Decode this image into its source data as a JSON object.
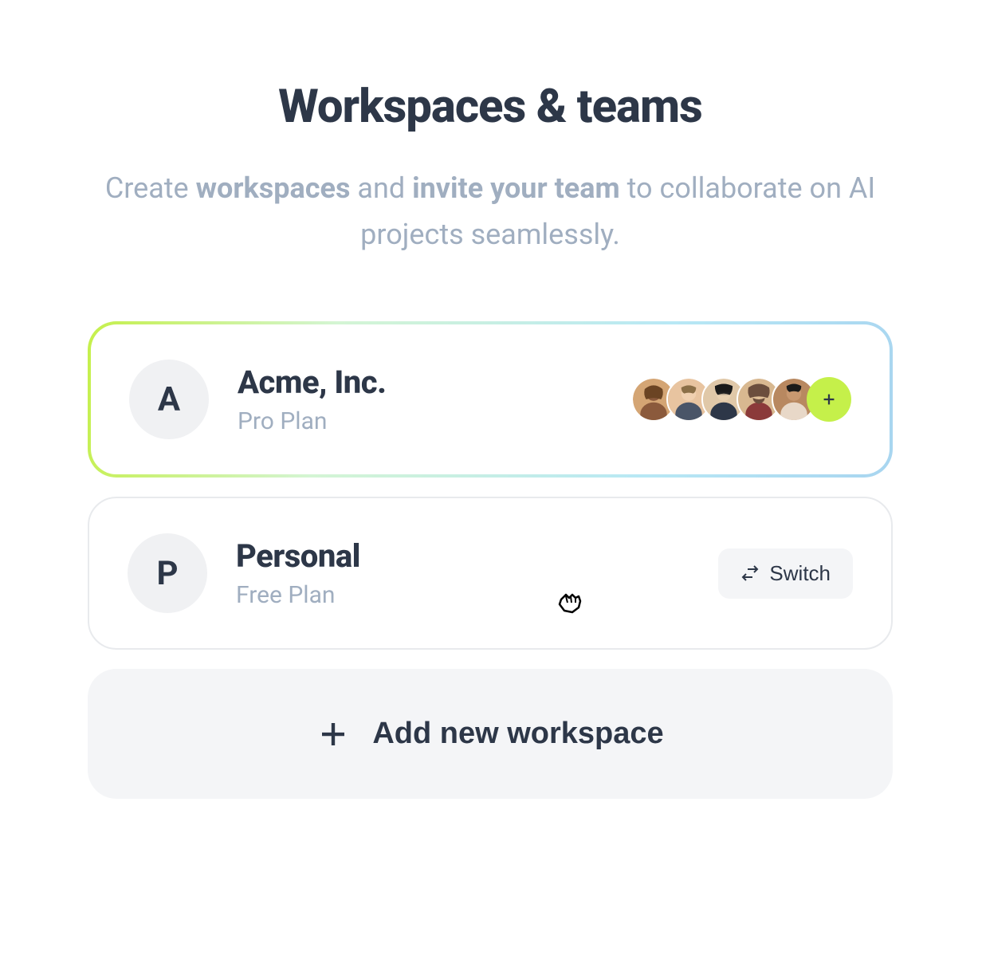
{
  "header": {
    "title": "Workspaces & teams",
    "subtitle_part1": "Create ",
    "subtitle_bold1": "workspaces",
    "subtitle_part2": " and ",
    "subtitle_bold2": "invite your team",
    "subtitle_part3": " to collaborate on AI projects seamlessly."
  },
  "workspaces": [
    {
      "initial": "A",
      "name": "Acme, Inc.",
      "plan": "Pro Plan",
      "active": true,
      "member_count": 5
    },
    {
      "initial": "P",
      "name": "Personal",
      "plan": "Free Plan",
      "active": false,
      "switch_label": "Switch"
    }
  ],
  "add_workspace_label": "Add new workspace",
  "colors": {
    "accent_lime": "#c5f04a",
    "text_dark": "#2d3748",
    "text_muted": "#a0aec0",
    "bg_light": "#f4f5f7"
  }
}
